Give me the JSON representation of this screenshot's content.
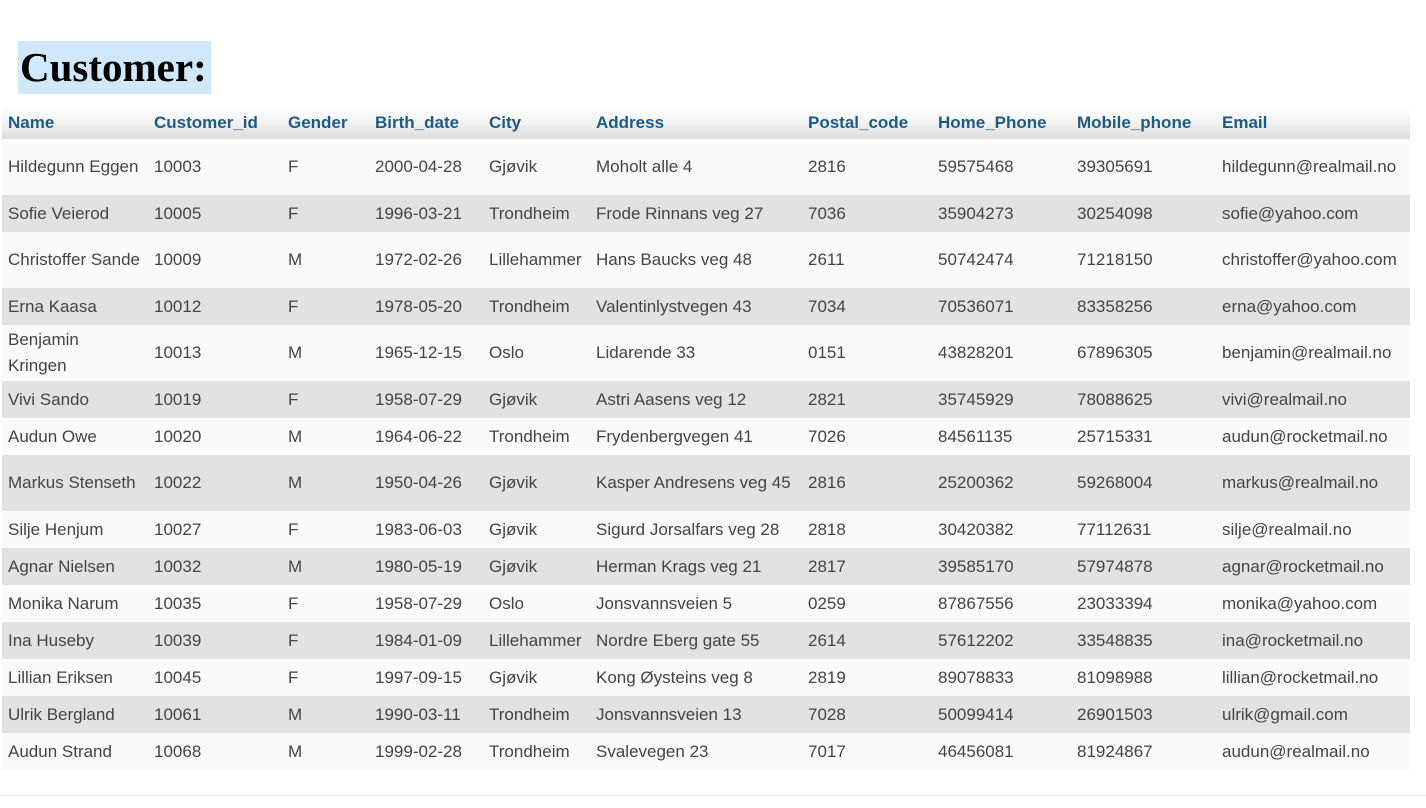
{
  "page": {
    "title": "Customer:"
  },
  "table": {
    "columns": [
      "Name",
      "Customer_id",
      "Gender",
      "Birth_date",
      "City",
      "Address",
      "Postal_code",
      "Home_Phone",
      "Mobile_phone",
      "Email"
    ],
    "rows": [
      [
        "Hildegunn Eggen",
        "10003",
        "F",
        "2000-04-28",
        "Gjøvik",
        "Moholt alle  4",
        "2816",
        "59575468",
        "39305691",
        "hildegunn@realmail.no"
      ],
      [
        "Sofie Veierod",
        "10005",
        "F",
        "1996-03-21",
        "Trondheim",
        "Frode Rinnans veg  27",
        "7036",
        "35904273",
        "30254098",
        "sofie@yahoo.com"
      ],
      [
        "Christoffer Sande",
        "10009",
        "M",
        "1972-02-26",
        "Lillehammer",
        "Hans Baucks veg  48",
        "2611",
        "50742474",
        "71218150",
        "christoffer@yahoo.com"
      ],
      [
        "Erna Kaasa",
        "10012",
        "F",
        "1978-05-20",
        "Trondheim",
        "Valentinlystvegen  43",
        "7034",
        "70536071",
        "83358256",
        "erna@yahoo.com"
      ],
      [
        "Benjamin Kringen",
        "10013",
        "M",
        "1965-12-15",
        "Oslo",
        "Lidarende  33",
        "0151",
        "43828201",
        "67896305",
        "benjamin@realmail.no"
      ],
      [
        "Vivi Sando",
        "10019",
        "F",
        "1958-07-29",
        "Gjøvik",
        "Astri Aasens veg  12",
        "2821",
        "35745929",
        "78088625",
        "vivi@realmail.no"
      ],
      [
        "Audun Owe",
        "10020",
        "M",
        "1964-06-22",
        "Trondheim",
        "Frydenbergvegen  41",
        "7026",
        "84561135",
        "25715331",
        "audun@rocketmail.no"
      ],
      [
        "Markus Stenseth",
        "10022",
        "M",
        "1950-04-26",
        "Gjøvik",
        "Kasper Andresens veg  45",
        "2816",
        "25200362",
        "59268004",
        "markus@realmail.no"
      ],
      [
        "Silje Henjum",
        "10027",
        "F",
        "1983-06-03",
        "Gjøvik",
        "Sigurd Jorsalfars veg  28",
        "2818",
        "30420382",
        "77112631",
        "silje@realmail.no"
      ],
      [
        "Agnar Nielsen",
        "10032",
        "M",
        "1980-05-19",
        "Gjøvik",
        "Herman Krags veg  21",
        "2817",
        "39585170",
        "57974878",
        "agnar@rocketmail.no"
      ],
      [
        "Monika Narum",
        "10035",
        "F",
        "1958-07-29",
        "Oslo",
        "Jonsvannsveien  5",
        "0259",
        "87867556",
        "23033394",
        "monika@yahoo.com"
      ],
      [
        "Ina Huseby",
        "10039",
        "F",
        "1984-01-09",
        "Lillehammer",
        "Nordre Eberg gate  55",
        "2614",
        "57612202",
        "33548835",
        "ina@rocketmail.no"
      ],
      [
        "Lillian Eriksen",
        "10045",
        "F",
        "1997-09-15",
        "Gjøvik",
        "Kong Øysteins veg  8",
        "2819",
        "89078833",
        "81098988",
        "lillian@rocketmail.no"
      ],
      [
        "Ulrik Bergland",
        "10061",
        "M",
        "1990-03-11",
        "Trondheim",
        "Jonsvannsveien  13",
        "7028",
        "50099414",
        "26901503",
        "ulrik@gmail.com"
      ],
      [
        "Audun Strand",
        "10068",
        "M",
        "1999-02-28",
        "Trondheim",
        "Svalevegen  23",
        "7017",
        "46456081",
        "81924867",
        "audun@realmail.no"
      ]
    ]
  },
  "colors": {
    "title_highlight": "#cfe8fc",
    "header_text": "#1e5a86",
    "body_text": "#444444",
    "row_odd": "#fafafa",
    "row_even": "#e2e2e2"
  }
}
